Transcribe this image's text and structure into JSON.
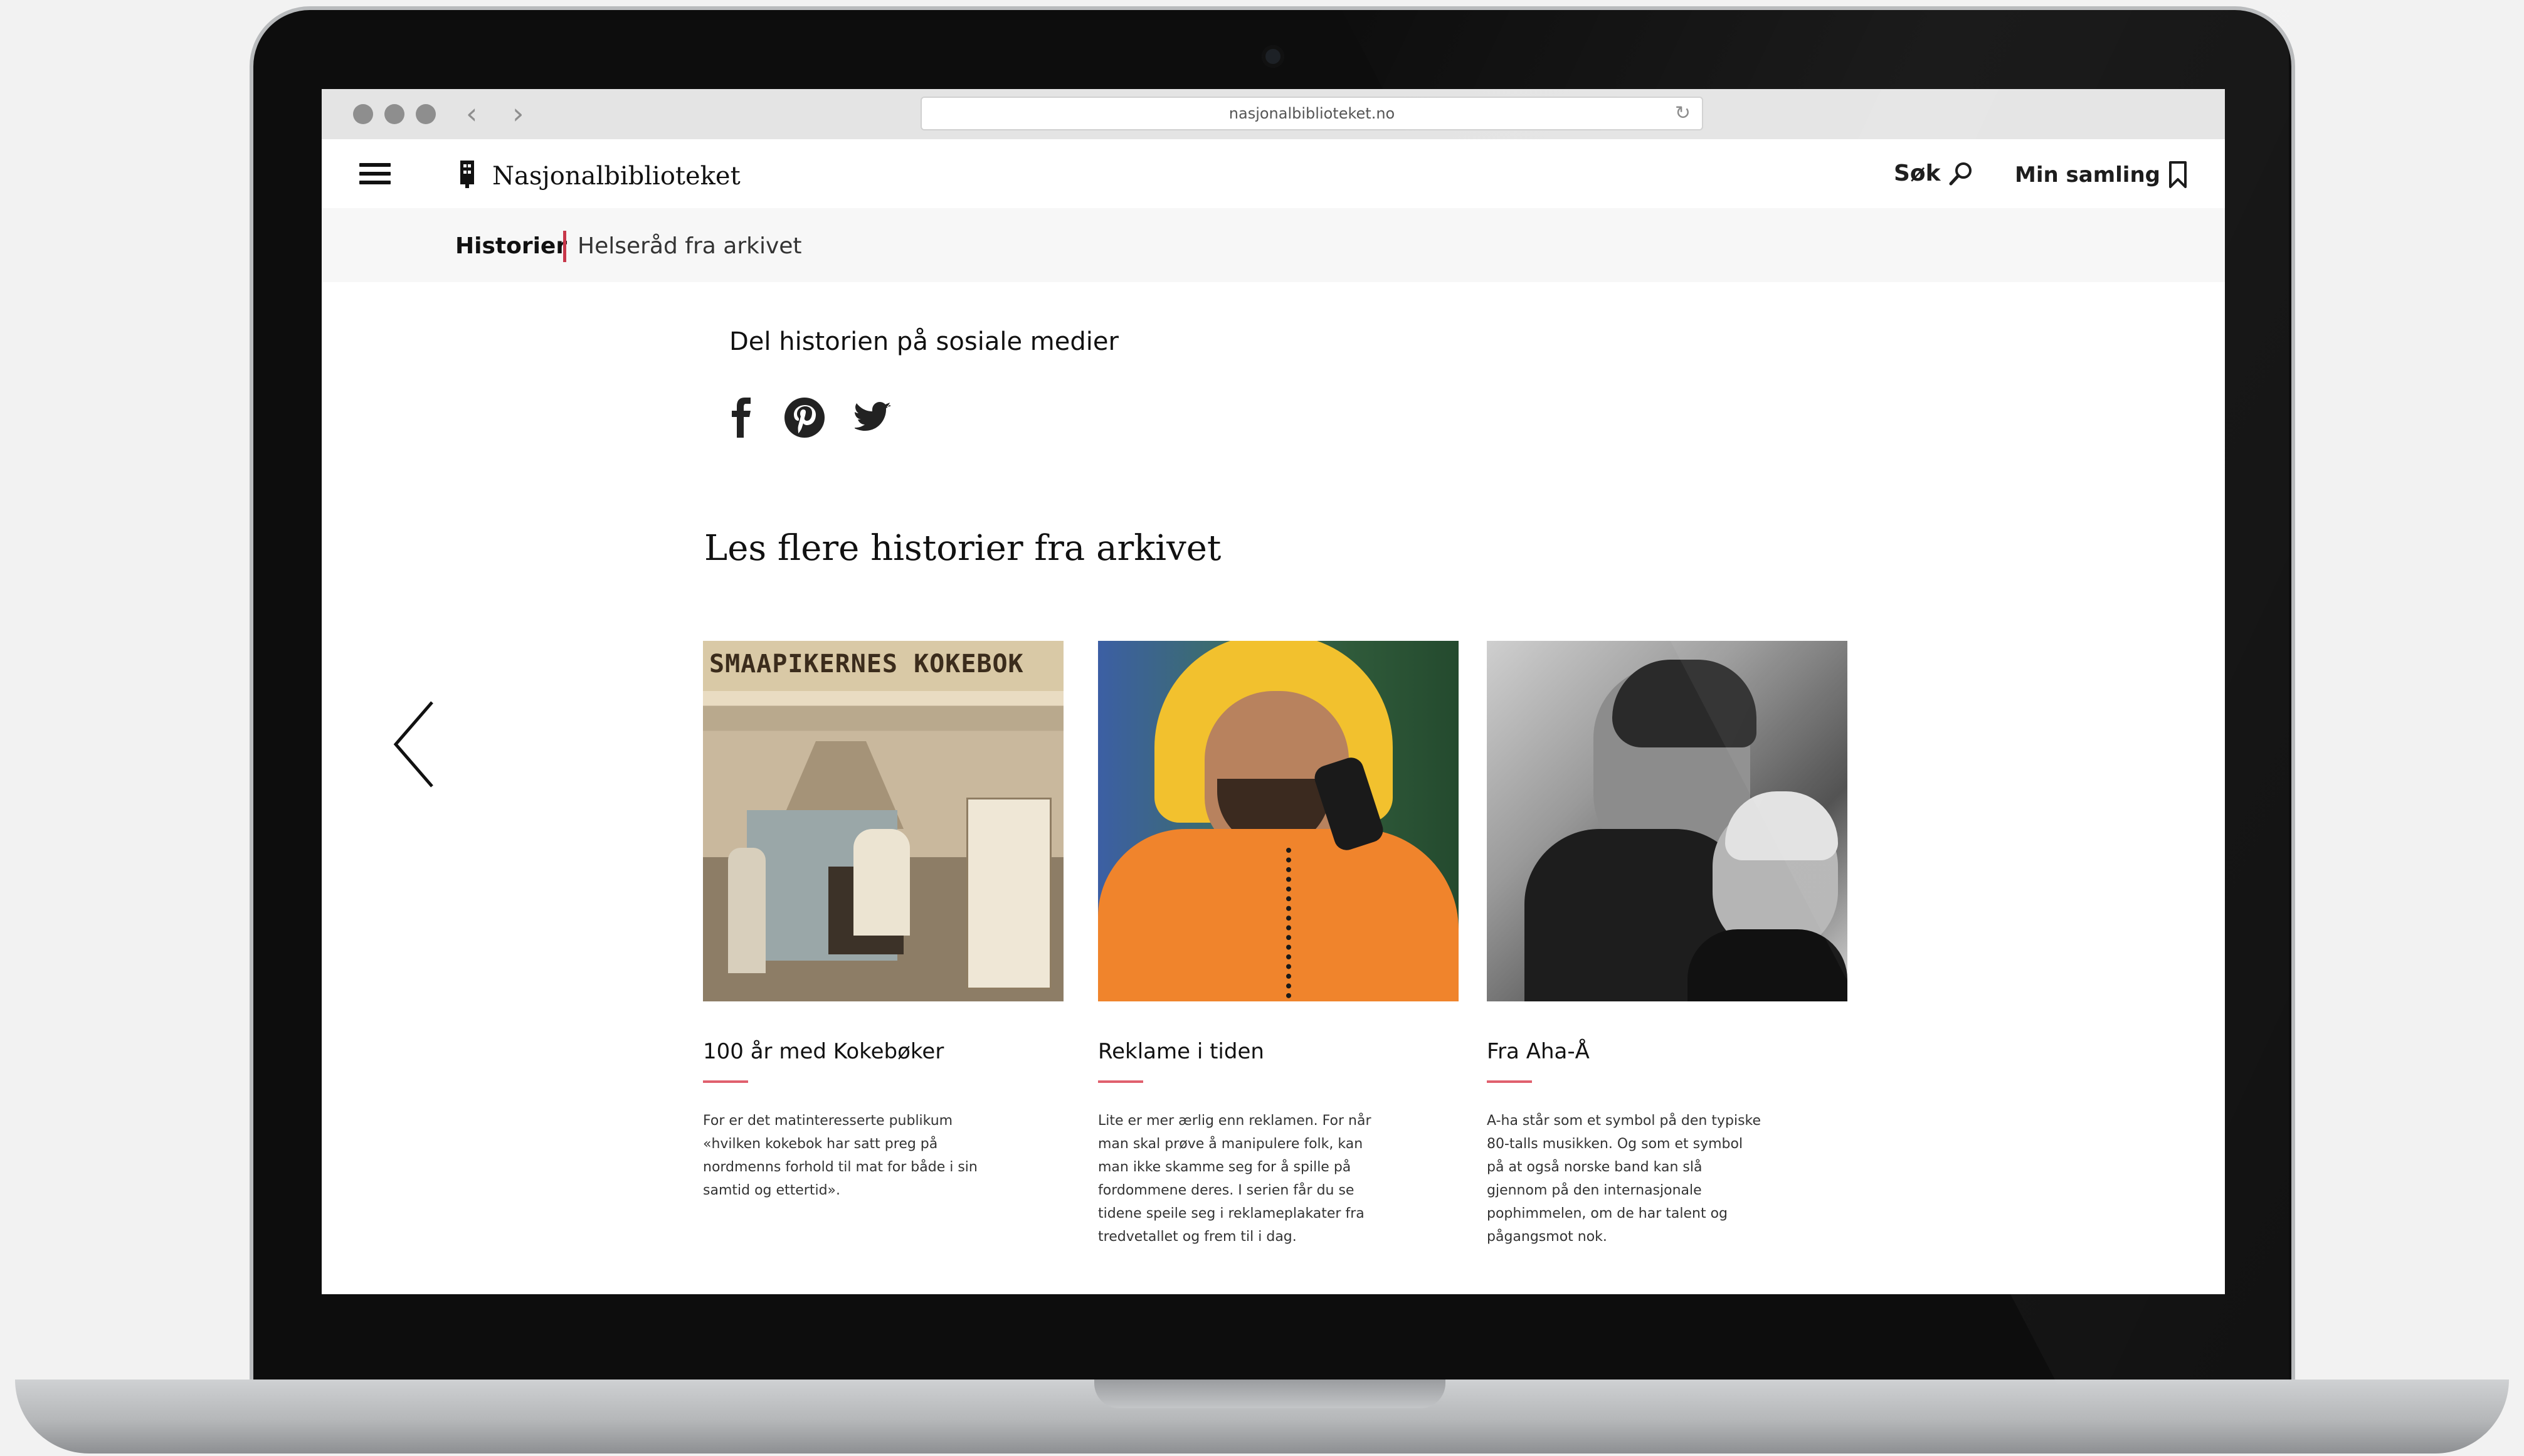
{
  "browser": {
    "url": "nasjonalbiblioteket.no",
    "back_icon": "chevron-left-icon",
    "forward_icon": "chevron-right-icon",
    "reload_icon": "reload-icon"
  },
  "header": {
    "logo_text": "Nasjonalbiblioteket",
    "search_label": "Søk",
    "collection_label": "Min samling"
  },
  "breadcrumb": {
    "section": "Historier",
    "page": "Helseråd fra arkivet"
  },
  "share": {
    "title": "Del historien på sosiale medier",
    "icons": [
      "facebook-icon",
      "pinterest-icon",
      "twitter-icon"
    ]
  },
  "more": {
    "title": "Les flere historier fra arkivet",
    "cards": [
      {
        "image_text": "SMAAPIKERNES KOKEBOK",
        "title": "100 år med Kokebøker",
        "description": "For er det matinteresserte publikum «hvilken kokebok har satt preg på nordmenns forhold til mat for både i sin samtid og ettertid»."
      },
      {
        "image_text": "",
        "title": "Reklame i tiden",
        "description": "Lite er mer ærlig enn reklamen. For når man skal prøve å manipulere folk, kan man ikke skamme seg for å spille på fordommene deres. I serien får du se tidene speile seg i reklameplakater fra tredvetallet og frem til i dag."
      },
      {
        "image_text": "",
        "title": "Fra Aha-Å",
        "description": "A-ha står som et symbol på den typiske 80-talls musikken. Og som et symbol på at også norske band kan slå gjennom på den internasjonale pophimmelen, om de har talent og pågangsmot nok."
      }
    ]
  },
  "colors": {
    "accent": "#c8374a",
    "card_rule": "#e0606e"
  }
}
